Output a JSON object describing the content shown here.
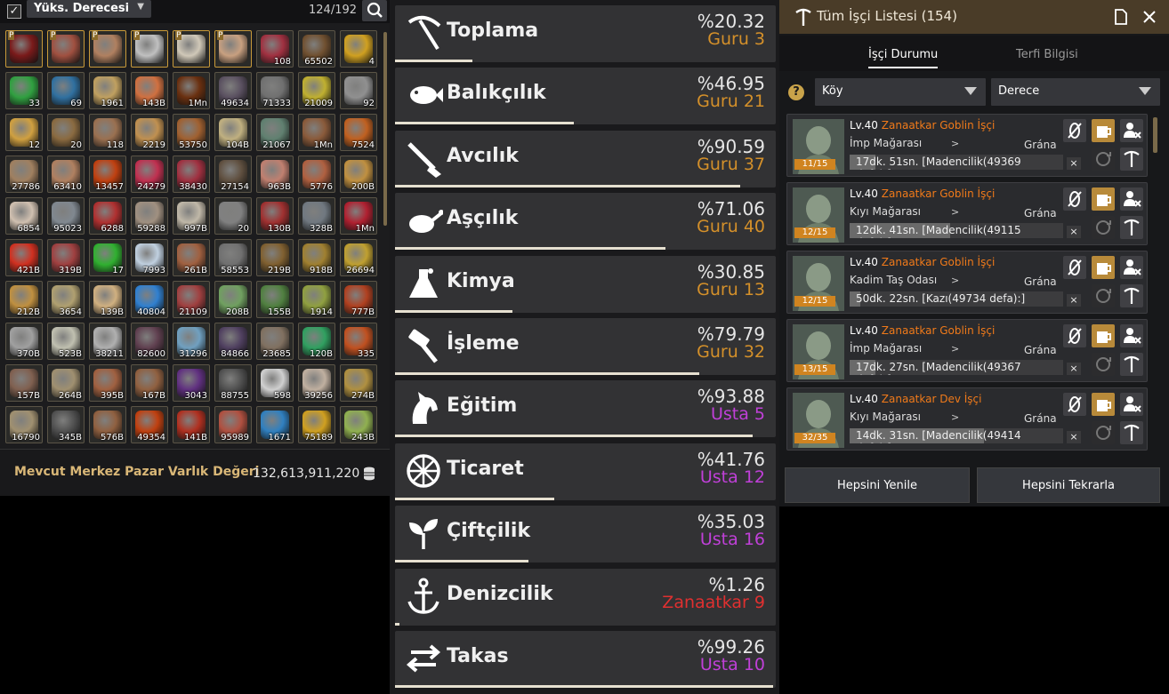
{
  "inventory": {
    "checkbox_mark": "✓",
    "sort_label": "Yüks. Derecesi",
    "count": "124/192",
    "footer_label": "Mevcut Merkez Pazar Varlık Değeri",
    "footer_value": "132,613,911,220",
    "items": [
      {
        "q": "",
        "p": true,
        "c": "#7a1a1a"
      },
      {
        "q": "",
        "p": true,
        "c": "#a05040"
      },
      {
        "q": "",
        "p": true,
        "c": "#b08060"
      },
      {
        "q": "",
        "p": true,
        "c": "#c0c0c0"
      },
      {
        "q": "",
        "p": true,
        "c": "#d0c8b8"
      },
      {
        "q": "",
        "p": true,
        "c": "#c8a080"
      },
      {
        "q": "108",
        "p": false,
        "c": "#a03040"
      },
      {
        "q": "65502",
        "p": false,
        "c": "#705030"
      },
      {
        "q": "4",
        "p": false,
        "c": "#d0a020"
      },
      {
        "q": "33",
        "p": false,
        "c": "#30a040"
      },
      {
        "q": "69",
        "p": false,
        "c": "#3070a0"
      },
      {
        "q": "1961",
        "p": false,
        "c": "#c0a060"
      },
      {
        "q": "143B",
        "p": false,
        "c": "#d07040"
      },
      {
        "q": "1Mn",
        "p": false,
        "c": "#6a3010"
      },
      {
        "q": "49634",
        "p": false,
        "c": "#5a5060"
      },
      {
        "q": "71333",
        "p": false,
        "c": "#707070"
      },
      {
        "q": "21009",
        "p": false,
        "c": "#c0b030"
      },
      {
        "q": "92",
        "p": false,
        "c": "#909090"
      },
      {
        "q": "12",
        "p": false,
        "c": "#d0a040"
      },
      {
        "q": "20",
        "p": false,
        "c": "#8a6a40"
      },
      {
        "q": "118",
        "p": false,
        "c": "#9a7050"
      },
      {
        "q": "2219",
        "p": false,
        "c": "#c09050"
      },
      {
        "q": "53750",
        "p": false,
        "c": "#a06030"
      },
      {
        "q": "104B",
        "p": false,
        "c": "#c0b080"
      },
      {
        "q": "21067",
        "p": false,
        "c": "#608070"
      },
      {
        "q": "1Mn",
        "p": false,
        "c": "#8a5a3a"
      },
      {
        "q": "7524",
        "p": false,
        "c": "#c06020"
      },
      {
        "q": "27786",
        "p": false,
        "c": "#a08060"
      },
      {
        "q": "63410",
        "p": false,
        "c": "#b08060"
      },
      {
        "q": "13457",
        "p": false,
        "c": "#c04010"
      },
      {
        "q": "24279",
        "p": false,
        "c": "#c03050"
      },
      {
        "q": "38430",
        "p": false,
        "c": "#a03040"
      },
      {
        "q": "27154",
        "p": false,
        "c": "#605040"
      },
      {
        "q": "963B",
        "p": false,
        "c": "#c08070"
      },
      {
        "q": "5776",
        "p": false,
        "c": "#b06040"
      },
      {
        "q": "200B",
        "p": false,
        "c": "#c09040"
      },
      {
        "q": "6854",
        "p": false,
        "c": "#d0c0b0"
      },
      {
        "q": "95023",
        "p": false,
        "c": "#808890"
      },
      {
        "q": "6288",
        "p": false,
        "c": "#b03030"
      },
      {
        "q": "59288",
        "p": false,
        "c": "#a09080"
      },
      {
        "q": "997B",
        "p": false,
        "c": "#c0b8a8"
      },
      {
        "q": "20",
        "p": false,
        "c": "#808080"
      },
      {
        "q": "130B",
        "p": false,
        "c": "#a03030"
      },
      {
        "q": "328B",
        "p": false,
        "c": "#707880"
      },
      {
        "q": "1Mn",
        "p": false,
        "c": "#b02030"
      },
      {
        "q": "421B",
        "p": false,
        "c": "#d03020"
      },
      {
        "q": "319B",
        "p": false,
        "c": "#a04040"
      },
      {
        "q": "17",
        "p": false,
        "c": "#30b030"
      },
      {
        "q": "7993",
        "p": false,
        "c": "#c0d0e0"
      },
      {
        "q": "261B",
        "p": false,
        "c": "#a06040"
      },
      {
        "q": "58553",
        "p": false,
        "c": "#707070"
      },
      {
        "q": "219B",
        "p": false,
        "c": "#806030"
      },
      {
        "q": "918B",
        "p": false,
        "c": "#a08030"
      },
      {
        "q": "26694",
        "p": false,
        "c": "#c0a030"
      },
      {
        "q": "212B",
        "p": false,
        "c": "#c09040"
      },
      {
        "q": "3654",
        "p": false,
        "c": "#b0a070"
      },
      {
        "q": "139B",
        "p": false,
        "c": "#d0b080"
      },
      {
        "q": "40804",
        "p": false,
        "c": "#3080d0"
      },
      {
        "q": "21109",
        "p": false,
        "c": "#a04040"
      },
      {
        "q": "208B",
        "p": false,
        "c": "#70a060"
      },
      {
        "q": "155B",
        "p": false,
        "c": "#508040"
      },
      {
        "q": "1914",
        "p": false,
        "c": "#90a040"
      },
      {
        "q": "777B",
        "p": false,
        "c": "#b04020"
      },
      {
        "q": "370B",
        "p": false,
        "c": "#a0a0a0"
      },
      {
        "q": "523B",
        "p": false,
        "c": "#c0c0b0"
      },
      {
        "q": "38211",
        "p": false,
        "c": "#b0b0b0"
      },
      {
        "q": "82600",
        "p": false,
        "c": "#604050"
      },
      {
        "q": "31296",
        "p": false,
        "c": "#70a0c0"
      },
      {
        "q": "84866",
        "p": false,
        "c": "#504060"
      },
      {
        "q": "23685",
        "p": false,
        "c": "#807060"
      },
      {
        "q": "120B",
        "p": false,
        "c": "#30a060"
      },
      {
        "q": "335",
        "p": false,
        "c": "#c05020"
      },
      {
        "q": "157B",
        "p": false,
        "c": "#806050"
      },
      {
        "q": "264B",
        "p": false,
        "c": "#a09070"
      },
      {
        "q": "395B",
        "p": false,
        "c": "#a06040"
      },
      {
        "q": "167B",
        "p": false,
        "c": "#906040"
      },
      {
        "q": "3043",
        "p": false,
        "c": "#603080"
      },
      {
        "q": "88755",
        "p": false,
        "c": "#505050"
      },
      {
        "q": "598",
        "p": false,
        "c": "#d0d0d0"
      },
      {
        "q": "39256",
        "p": false,
        "c": "#c0b0a0"
      },
      {
        "q": "274B",
        "p": false,
        "c": "#b09040"
      },
      {
        "q": "16790",
        "p": false,
        "c": "#a09070"
      },
      {
        "q": "345B",
        "p": false,
        "c": "#505050"
      },
      {
        "q": "576B",
        "p": false,
        "c": "#906040"
      },
      {
        "q": "49354",
        "p": false,
        "c": "#c04010"
      },
      {
        "q": "141B",
        "p": false,
        "c": "#b03020"
      },
      {
        "q": "95989",
        "p": false,
        "c": "#b05040"
      },
      {
        "q": "1671",
        "p": false,
        "c": "#3080c0"
      },
      {
        "q": "75189",
        "p": false,
        "c": "#d0a020"
      },
      {
        "q": "243B",
        "p": false,
        "c": "#90b050"
      }
    ]
  },
  "skills": [
    {
      "name": "Toplama",
      "pct": "%20.32",
      "rank": "Guru 3",
      "rank_color": "#d4902a",
      "progress": 0.2032,
      "icon": "pickaxe-icon"
    },
    {
      "name": "Balıkçılık",
      "pct": "%46.95",
      "rank": "Guru 21",
      "rank_color": "#d4902a",
      "progress": 0.4695,
      "icon": "fish-icon"
    },
    {
      "name": "Avcılık",
      "pct": "%90.59",
      "rank": "Guru 37",
      "rank_color": "#d4902a",
      "progress": 0.9059,
      "icon": "rifle-icon"
    },
    {
      "name": "Aşçılık",
      "pct": "%71.06",
      "rank": "Guru 40",
      "rank_color": "#d4902a",
      "progress": 0.7106,
      "icon": "chicken-icon"
    },
    {
      "name": "Kimya",
      "pct": "%30.85",
      "rank": "Guru 13",
      "rank_color": "#d4902a",
      "progress": 0.3085,
      "icon": "flask-icon"
    },
    {
      "name": "İşleme",
      "pct": "%79.79",
      "rank": "Guru 32",
      "rank_color": "#d4902a",
      "progress": 0.7979,
      "icon": "hammer-icon"
    },
    {
      "name": "Eğitim",
      "pct": "%93.88",
      "rank": "Usta 5",
      "rank_color": "#c040d8",
      "progress": 0.9388,
      "icon": "horse-icon"
    },
    {
      "name": "Ticaret",
      "pct": "%41.76",
      "rank": "Usta 12",
      "rank_color": "#c040d8",
      "progress": 0.4176,
      "icon": "wheel-icon"
    },
    {
      "name": "Çiftçilik",
      "pct": "%35.03",
      "rank": "Usta 16",
      "rank_color": "#c040d8",
      "progress": 0.3503,
      "icon": "sprout-icon"
    },
    {
      "name": "Denizcilik",
      "pct": "%1.26",
      "rank": "Zanaatkar 9",
      "rank_color": "#e03030",
      "progress": 0.0126,
      "icon": "anchor-icon"
    },
    {
      "name": "Takas",
      "pct": "%99.26",
      "rank": "Usta 10",
      "rank_color": "#c040d8",
      "progress": 0.9926,
      "icon": "swap-icon"
    }
  ],
  "workers": {
    "title": "Tüm İşçi Listesi (154)",
    "tab_status": "İşçi Durumu",
    "tab_promo": "Terfi Bilgisi",
    "filter_town": "Köy",
    "filter_grade": "Derece",
    "help_mark": "?",
    "refresh_all": "Hepsini Yenile",
    "repeat_all": "Hepsini Tekrarla",
    "list": [
      {
        "level": "Lv.40",
        "name": "Zanaatkar Goblin İşçi",
        "loc": "İmp Mağarası",
        "town": "Grána",
        "count": "11/15",
        "task": "17dk. 51sn. [Madencilik(49369 defa):]",
        "progress": 0.12,
        "arrow": ">",
        "close": "×"
      },
      {
        "level": "Lv.40",
        "name": "Zanaatkar Goblin İşçi",
        "loc": "Kıyı Mağarası",
        "town": "Grána",
        "count": "12/15",
        "task": "12dk. 41sn. [Madencilik(49115 defa):]",
        "progress": 0.47,
        "arrow": ">",
        "close": "×"
      },
      {
        "level": "Lv.40",
        "name": "Zanaatkar Goblin İşçi",
        "loc": "Kadim Taş Odası",
        "town": "Grána",
        "count": "12/15",
        "task": "50dk. 22sn. [Kazı(49734 defa):]",
        "progress": 0.05,
        "arrow": ">",
        "close": "×"
      },
      {
        "level": "Lv.40",
        "name": "Zanaatkar Goblin İşçi",
        "loc": "İmp Mağarası",
        "town": "Grána",
        "count": "13/15",
        "task": "17dk. 27sn. [Madencilik(49367 defa):]",
        "progress": 0.12,
        "arrow": ">",
        "close": "×"
      },
      {
        "level": "Lv.40",
        "name": "Zanaatkar Dev İşçi",
        "loc": "Kıyı Mağarası",
        "town": "Grána",
        "count": "32/35",
        "task": "14dk. 31sn. [Madencilik(49414 defa):]",
        "progress": 0.63,
        "arrow": ">",
        "close": "×"
      }
    ]
  }
}
